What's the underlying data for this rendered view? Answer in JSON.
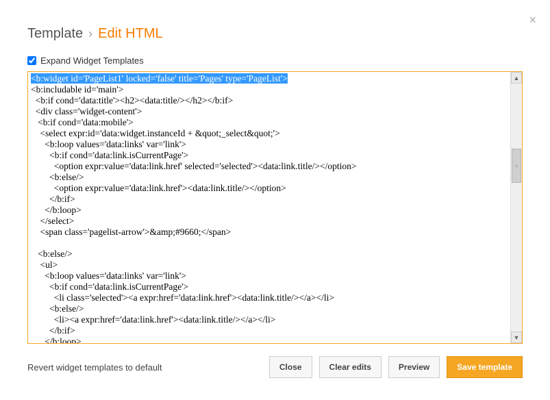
{
  "header": {
    "breadcrumb_root": "Template",
    "breadcrumb_sep": "›",
    "breadcrumb_current": "Edit HTML"
  },
  "checkbox": {
    "label": "Expand Widget Templates",
    "checked": true
  },
  "code": {
    "highlighted_line": "<b:widget id='PageList1' locked='false' title='Pages' type='PageList'>",
    "lines": [
      "<b:includable id='main'>",
      "  <b:if cond='data:title'><h2><data:title/></h2></b:if>",
      "  <div class='widget-content'>",
      "   <b:if cond='data:mobile'>",
      "    <select expr:id='data:widget.instanceId + &quot;_select&quot;'>",
      "      <b:loop values='data:links' var='link'>",
      "        <b:if cond='data:link.isCurrentPage'>",
      "          <option expr:value='data:link.href' selected='selected'><data:link.title/></option>",
      "        <b:else/>",
      "          <option expr:value='data:link.href'><data:link.title/></option>",
      "        </b:if>",
      "      </b:loop>",
      "    </select>",
      "    <span class='pagelist-arrow'>&amp;#9660;</span>",
      "",
      "   <b:else/>",
      "    <ul>",
      "      <b:loop values='data:links' var='link'>",
      "        <b:if cond='data:link.isCurrentPage'>",
      "          <li class='selected'><a expr:href='data:link.href'><data:link.title/></a></li>",
      "        <b:else/>",
      "          <li><a expr:href='data:link.href'><data:link.title/></a></li>",
      "        </b:if>",
      "      </b:loop>"
    ]
  },
  "footer": {
    "revert_label": "Revert widget templates to default",
    "buttons": {
      "close": "Close",
      "clear": "Clear edits",
      "preview": "Preview",
      "save": "Save template"
    }
  }
}
